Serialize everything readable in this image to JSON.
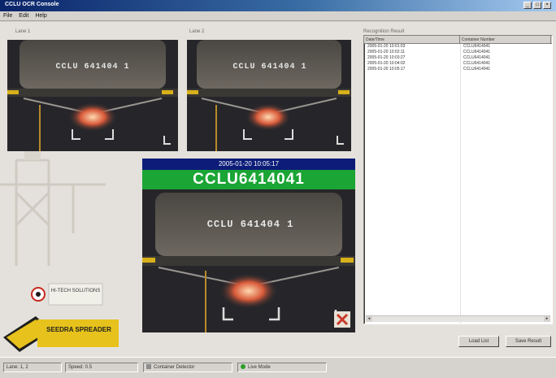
{
  "window": {
    "title": "CCLU OCR Console",
    "controls": {
      "minimize": "_",
      "maximize": "□",
      "close": "×"
    }
  },
  "menu": [
    "File",
    "Edit",
    "Help"
  ],
  "cameras": {
    "lane1": {
      "label": "Lane 1",
      "plate_text": "CCLU 641404 1"
    },
    "lane2": {
      "label": "Lane 2",
      "plate_text": "CCLU 641404 1"
    },
    "main": {
      "plate_text": "CCLU 641404 1"
    }
  },
  "result": {
    "datetime": "2005-01-20 10:05:17",
    "container_number": "CCLU6414041"
  },
  "recognition_panel": {
    "title": "Recognition Result",
    "columns": [
      "Date/Time",
      "Container Number"
    ],
    "rows": [
      [
        "2005-01-20 10:01:03",
        "CCLU6414041"
      ],
      [
        "2005-01-20 10:02:11",
        "CCLU6414041"
      ],
      [
        "2005-01-20 10:03:27",
        "CCLU6414041"
      ],
      [
        "2005-01-20 10:04:02",
        "CCLU6414041"
      ],
      [
        "2005-01-20 10:05:17",
        "CCLU6414041"
      ]
    ]
  },
  "buttons": {
    "load": "Load List",
    "save": "Save Result"
  },
  "logos": {
    "badge_text": "HI-TECH SOLUTIONS",
    "company_text": "SEEDRA SPREADER"
  },
  "status": {
    "panes": [
      "Lane: 1, 2",
      "Speed: 0.5",
      "Container Detector",
      "Live Mode"
    ],
    "colors": {
      "detector": "#8c8c8c",
      "live": "#2a9d2a"
    }
  },
  "colors": {
    "date_band": "#0c1c78",
    "plate_band": "#1aa534",
    "titlebar": "#0a246a"
  }
}
